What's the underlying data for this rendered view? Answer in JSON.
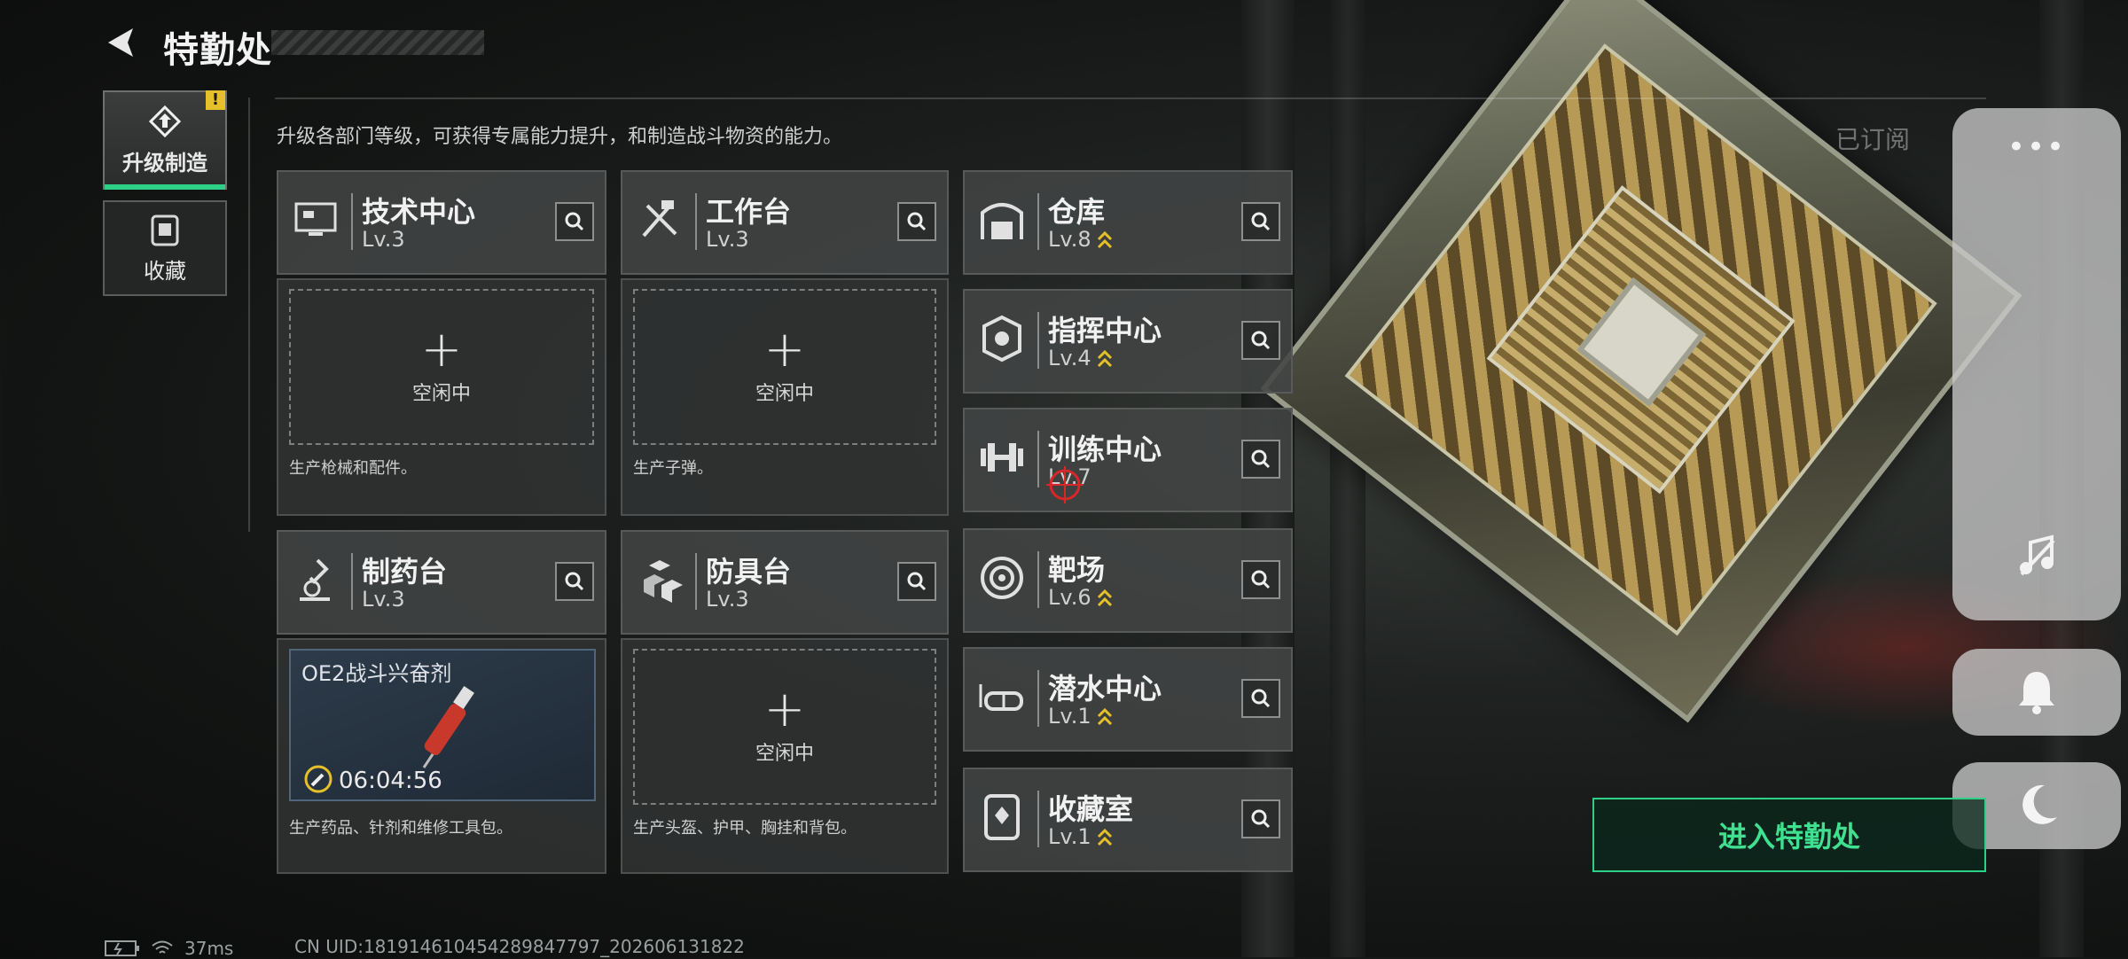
{
  "header": {
    "title": "特勤处",
    "subtitle": "升级各部门等级，可获得专属能力提升，和制造战斗物资的能力。"
  },
  "side_tabs": [
    {
      "label": "升级制造",
      "icon": "upgrade-craft-icon",
      "active": true,
      "badge": "!"
    },
    {
      "label": "收藏",
      "icon": "collection-icon",
      "active": false
    }
  ],
  "workstations": [
    {
      "name": "技术中心",
      "level": "Lv.3",
      "icon": "tech-center-icon",
      "status": "空闲中",
      "description": "生产枪械和配件。"
    },
    {
      "name": "工作台",
      "level": "Lv.3",
      "icon": "workbench-icon",
      "status": "空闲中",
      "description": "生产子弹。"
    },
    {
      "name": "制药台",
      "level": "Lv.3",
      "icon": "pharmacy-icon",
      "description": "生产药品、针剂和维修工具包。",
      "crafting": {
        "item": "OE2战斗兴奋剂",
        "timer": "06:04:56"
      }
    },
    {
      "name": "防具台",
      "level": "Lv.3",
      "icon": "armor-bench-icon",
      "status": "空闲中",
      "description": "生产头盔、护甲、胸挂和背包。"
    }
  ],
  "facilities": [
    {
      "name": "仓库",
      "level": "Lv.8",
      "icon": "warehouse-icon",
      "upgradable": true
    },
    {
      "name": "指挥中心",
      "level": "Lv.4",
      "icon": "command-center-icon",
      "upgradable": true
    },
    {
      "name": "训练中心",
      "level": "Lv.7",
      "icon": "training-center-icon",
      "upgradable": false
    },
    {
      "name": "靶场",
      "level": "Lv.6",
      "icon": "shooting-range-icon",
      "upgradable": true
    },
    {
      "name": "潜水中心",
      "level": "Lv.1",
      "icon": "diving-center-icon",
      "upgradable": true
    },
    {
      "name": "收藏室",
      "level": "Lv.1",
      "icon": "collection-room-icon",
      "upgradable": true
    }
  ],
  "right": {
    "subscribed": "已订阅",
    "enter_button": "进入特勤处"
  },
  "status_bar": {
    "ping": "37ms",
    "uid": "CN UID:181914610454289847797_202606131822"
  },
  "colors": {
    "accent": "#2ecf86",
    "upgrade": "#e4c02a",
    "warning": "#e4c02a"
  }
}
